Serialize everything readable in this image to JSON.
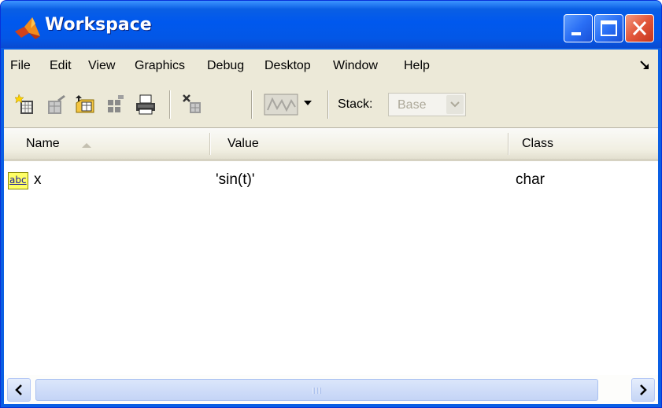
{
  "window": {
    "title": "Workspace"
  },
  "titlebar_buttons": [
    "minimize-button",
    "maximize-button",
    "close-button"
  ],
  "menu": {
    "items": [
      "File",
      "Edit",
      "View",
      "Graphics",
      "Debug",
      "Desktop",
      "Window",
      "Help"
    ]
  },
  "toolbar": {
    "icons": [
      "new-variable-icon",
      "open-selection-icon",
      "import-data-icon",
      "save-icon",
      "print-icon",
      "delete-icon",
      "plot-selection-icon",
      "dropdown-arrow-icon"
    ],
    "stack_label": "Stack:",
    "stack_value": "Base"
  },
  "table": {
    "columns": [
      "Name",
      "Value",
      "Class"
    ],
    "sort_column": "Name",
    "sort_direction": "ascending",
    "rows": [
      {
        "icon_text": "abc",
        "name": "x",
        "value": "'sin(t)'",
        "class": "char"
      }
    ]
  },
  "colors": {
    "titlebar": "#0058ee",
    "chrome": "#ece9d8",
    "close_button": "#e2563a",
    "variable_icon": "#ffff66"
  }
}
